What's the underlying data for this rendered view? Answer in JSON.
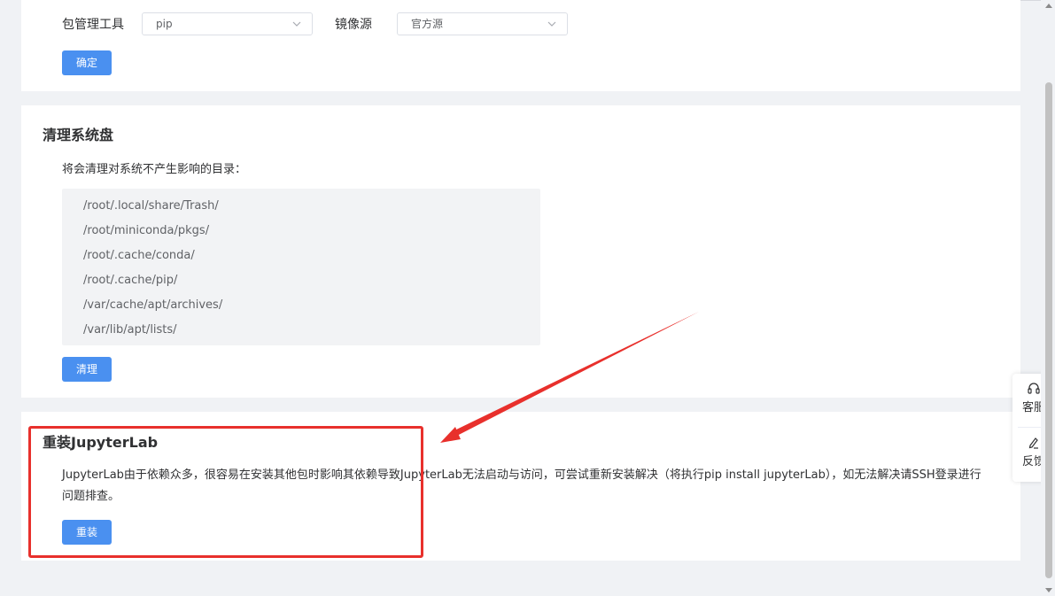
{
  "package_settings": {
    "package_tool_label": "包管理工具",
    "package_tool_value": "pip",
    "mirror_label": "镜像源",
    "mirror_value": "官方源",
    "confirm_label": "确定"
  },
  "clean_disk": {
    "title": "清理系统盘",
    "description": "将会清理对系统不产生影响的目录：",
    "paths": [
      "/root/.local/share/Trash/",
      "/root/miniconda/pkgs/",
      "/root/.cache/conda/",
      "/root/.cache/pip/",
      "/var/cache/apt/archives/",
      "/var/lib/apt/lists/"
    ],
    "clean_label": "清理"
  },
  "reinstall": {
    "title": "重装JupyterLab",
    "description": "JupyterLab由于依赖众多，很容易在安装其他包时影响其依赖导致JupyterLab无法启动与访问，可尝试重新安装解决（将执行pip install jupyterLab），如无法解决请SSH登录进行问题排查。",
    "reinstall_label": "重装"
  },
  "float_panel": {
    "service_label": "客服",
    "service_icon": "headset-icon",
    "feedback_label": "反馈",
    "feedback_icon": "edit-icon"
  },
  "colors": {
    "primary": "#4a90f0",
    "annotation": "#e8302c",
    "background": "#f0f2f5"
  }
}
